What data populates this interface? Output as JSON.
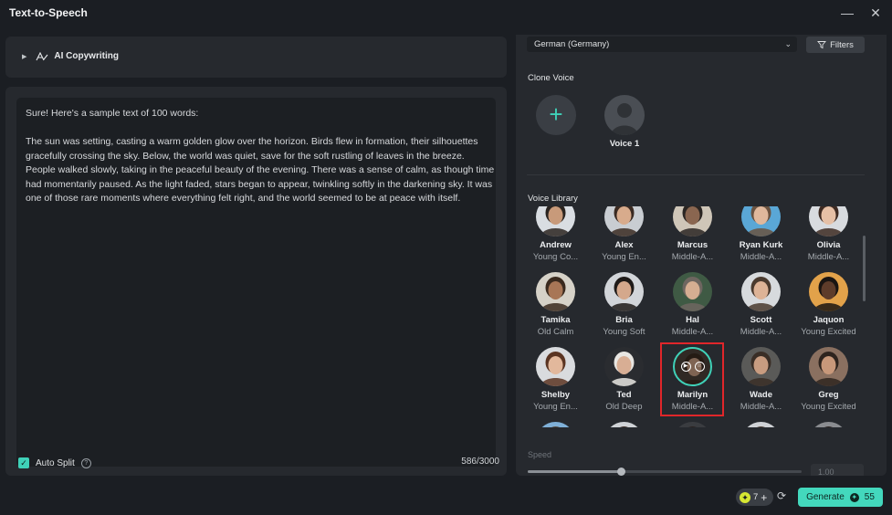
{
  "window": {
    "title": "Text-to-Speech",
    "minimize": "—",
    "close": "✕"
  },
  "copywriting": {
    "label": "AI Copywriting"
  },
  "editor": {
    "text": "Sure! Here's a sample text of 100 words:\n\nThe sun was setting, casting a warm golden glow over the horizon. Birds flew in formation, their silhouettes gracefully crossing the sky. Below, the world was quiet, save for the soft rustling of leaves in the breeze. People walked slowly, taking in the peaceful beauty of the evening. There was a sense of calm, as though time had momentarily paused. As the light faded, stars began to appear, twinkling softly in the darkening sky. It was one of those rare moments where everything felt right, and the world seemed to be at peace with itself.",
    "auto_split_label": "Auto Split",
    "char_count": "586/3000"
  },
  "voice_panel": {
    "language": "German (Germany)",
    "filters_label": "Filters",
    "clone_title": "Clone Voice",
    "clone_voice_name": "Voice 1",
    "library_title": "Voice Library",
    "speed_label": "Speed",
    "speed_value": "1.00",
    "speed_level": 0.34
  },
  "voices": [
    {
      "name": "Andrew",
      "desc": "Young Co...",
      "skin": "#c89a7a",
      "hair": "#2a2420",
      "bg": "#d9dde2"
    },
    {
      "name": "Alex",
      "desc": "Young En...",
      "skin": "#d8ab8c",
      "hair": "#3a2a22",
      "bg": "#c9cdd2"
    },
    {
      "name": "Marcus",
      "desc": "Middle-A...",
      "skin": "#8a6650",
      "hair": "#2a2522",
      "bg": "#cfc6b8"
    },
    {
      "name": "Ryan Kurk",
      "desc": "Middle-A...",
      "skin": "#e0b89c",
      "hair": "#6a5240",
      "bg": "#5aa7d6"
    },
    {
      "name": "Olivia",
      "desc": "Middle-A...",
      "skin": "#e6c0a6",
      "hair": "#3d2a22",
      "bg": "#d8dbdf"
    },
    {
      "name": "Tamika",
      "desc": "Old Calm",
      "skin": "#a87656",
      "hair": "#3a2a1e",
      "bg": "#d6d2c8"
    },
    {
      "name": "Bria",
      "desc": "Young Soft",
      "skin": "#d4a88c",
      "hair": "#1e1a18",
      "bg": "#d2d5d9"
    },
    {
      "name": "Hal",
      "desc": "Middle-A...",
      "skin": "#d6ae92",
      "hair": "#6e6660",
      "bg": "#3f5a44"
    },
    {
      "name": "Scott",
      "desc": "Middle-A...",
      "skin": "#ddb396",
      "hair": "#4a3a2e",
      "bg": "#d7dadd"
    },
    {
      "name": "Jaquon",
      "desc": "Young Excited",
      "skin": "#5e3c2a",
      "hair": "#1a1512",
      "bg": "#e2a24a"
    },
    {
      "name": "Shelby",
      "desc": "Young En...",
      "skin": "#e2b89c",
      "hair": "#5a3422",
      "bg": "#d9dbde"
    },
    {
      "name": "Ted",
      "desc": "Old Deep",
      "skin": "#d8ae94",
      "hair": "#e8e6e2",
      "bg": "#2a2c30"
    },
    {
      "name": "Marilyn",
      "desc": "Middle-A...",
      "skin": "#c49a80",
      "hair": "#3a2a20",
      "bg": "#4a4038"
    },
    {
      "name": "Wade",
      "desc": "Middle-A...",
      "skin": "#c89c80",
      "hair": "#3a2e26",
      "bg": "#5a5a58"
    },
    {
      "name": "Greg",
      "desc": "Young Excited",
      "skin": "#c8987a",
      "hair": "#2e241e",
      "bg": "#8a7060"
    },
    {
      "name": "",
      "desc": "",
      "skin": "#d8b098",
      "hair": "#5a4a3a",
      "bg": "#7fb0d8"
    },
    {
      "name": "",
      "desc": "",
      "skin": "#d8b098",
      "hair": "#3a2a22",
      "bg": "#cfd2d6"
    },
    {
      "name": "",
      "desc": "",
      "skin": "#c89a80",
      "hair": "#2a2220",
      "bg": "#3a3c40"
    },
    {
      "name": "",
      "desc": "",
      "skin": "#d4aa90",
      "hair": "#4a3a30",
      "bg": "#cfd2d6"
    },
    {
      "name": "",
      "desc": "",
      "skin": "#c49478",
      "hair": "#2a2220",
      "bg": "#8a8c90"
    }
  ],
  "selected_voice": "Marilyn",
  "footer": {
    "credits": "7",
    "credits_plus": "+",
    "generate_label": "Generate",
    "generate_cost": "55"
  },
  "colors": {
    "accent": "#43d8bd",
    "selection": "#e0262a",
    "panel": "#26292e"
  }
}
